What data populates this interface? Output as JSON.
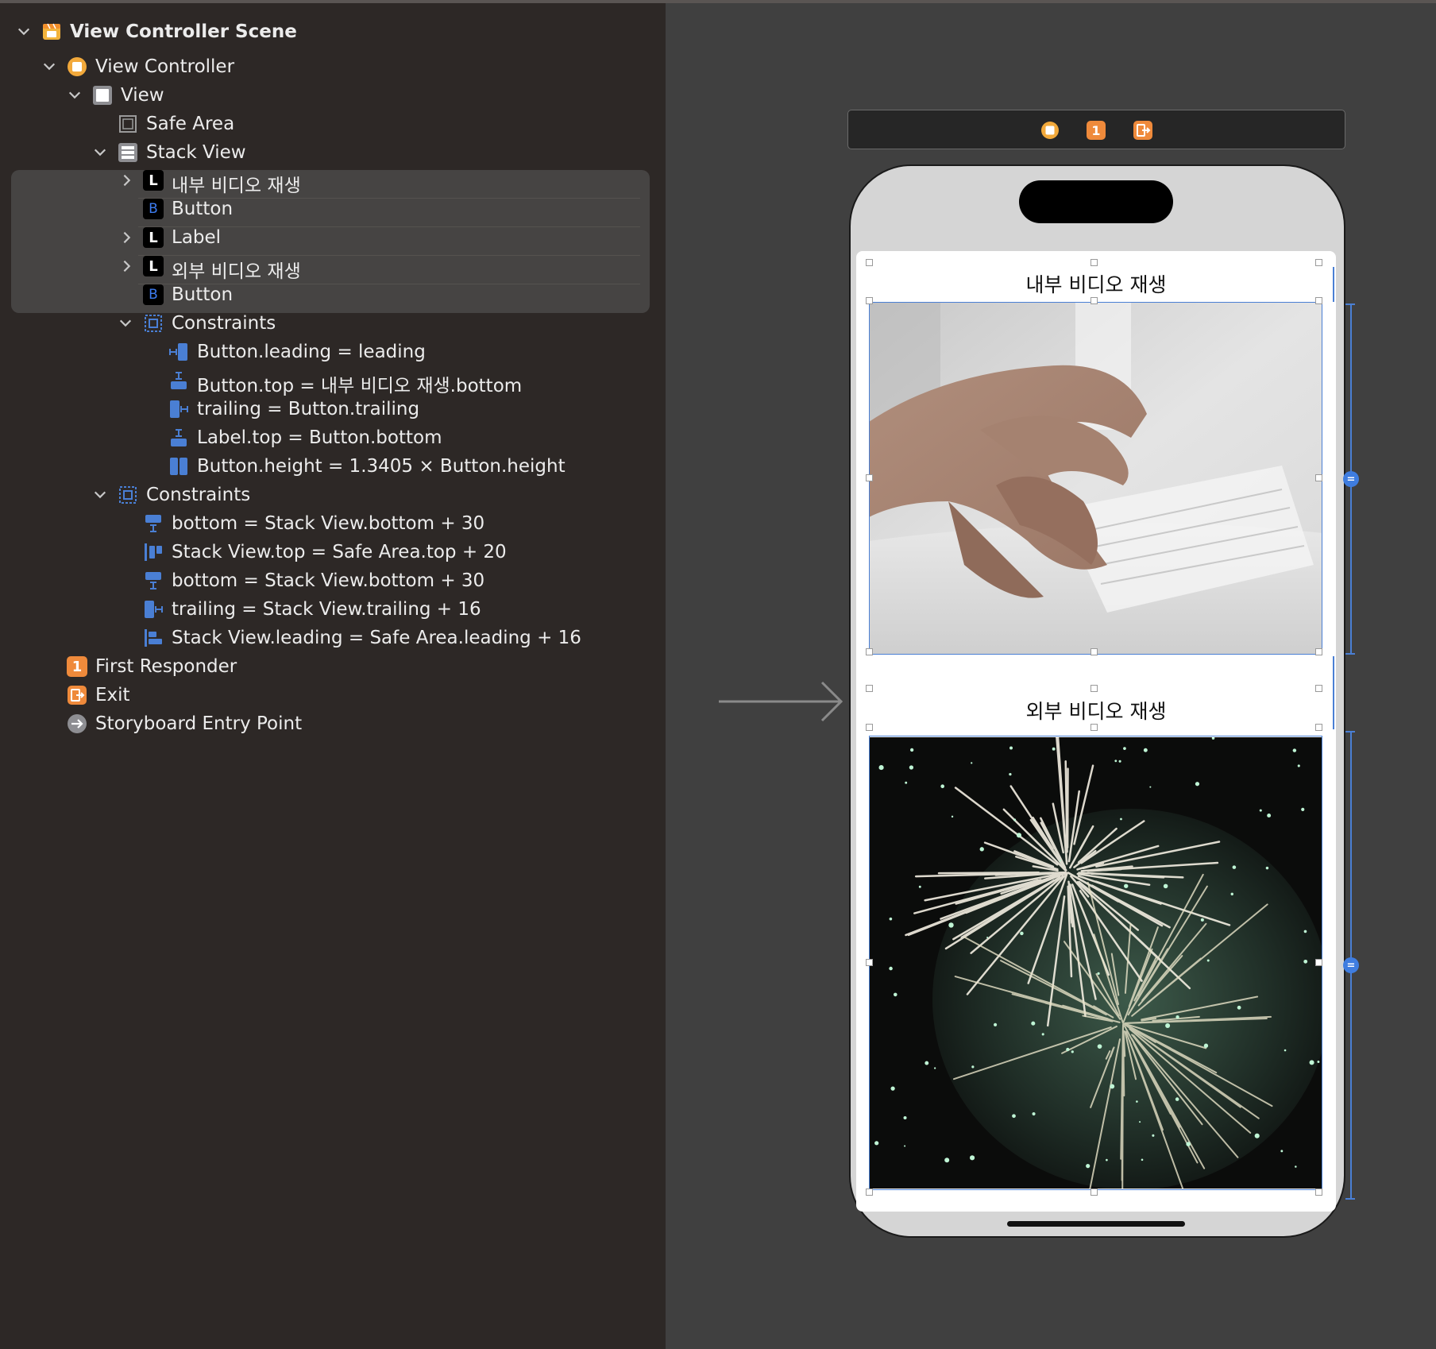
{
  "outline": {
    "scene": "View Controller Scene",
    "view_controller": "View Controller",
    "view": "View",
    "safe_area": "Safe Area",
    "stack_view": "Stack View",
    "stack_children": [
      {
        "badge": "L",
        "label": "내부 비디오 재생"
      },
      {
        "badge": "B",
        "label": "Button"
      },
      {
        "badge": "L",
        "label": "Label"
      },
      {
        "badge": "L",
        "label": "외부 비디오 재생"
      },
      {
        "badge": "B",
        "label": "Button"
      }
    ],
    "stack_constraints_title": "Constraints",
    "stack_constraints": [
      "Button.leading = leading",
      "Button.top = 내부 비디오 재생.bottom",
      "trailing = Button.trailing",
      "Label.top = Button.bottom",
      "Button.height = 1.3405 × Button.height"
    ],
    "view_constraints_title": "Constraints",
    "view_constraints": [
      "bottom = Stack View.bottom + 30",
      "Stack View.top = Safe Area.top + 20",
      "bottom = Stack View.bottom + 30",
      "trailing = Stack View.trailing + 16",
      "Stack View.leading = Safe Area.leading + 16"
    ],
    "first_responder": "First Responder",
    "first_responder_badge": "1",
    "exit": "Exit",
    "entry_point": "Storyboard Entry Point"
  },
  "canvas": {
    "scene_bar_first_responder_badge": "1",
    "label_internal": "내부 비디오 재생",
    "label_external": "외부 비디오 재생",
    "equal_marker": "="
  },
  "colors": {
    "outline_bg": "#2d2826",
    "canvas_bg": "#404040",
    "selection": "#464443",
    "constraint_blue": "#4a7fd4",
    "orange": "#ef8a3b"
  }
}
